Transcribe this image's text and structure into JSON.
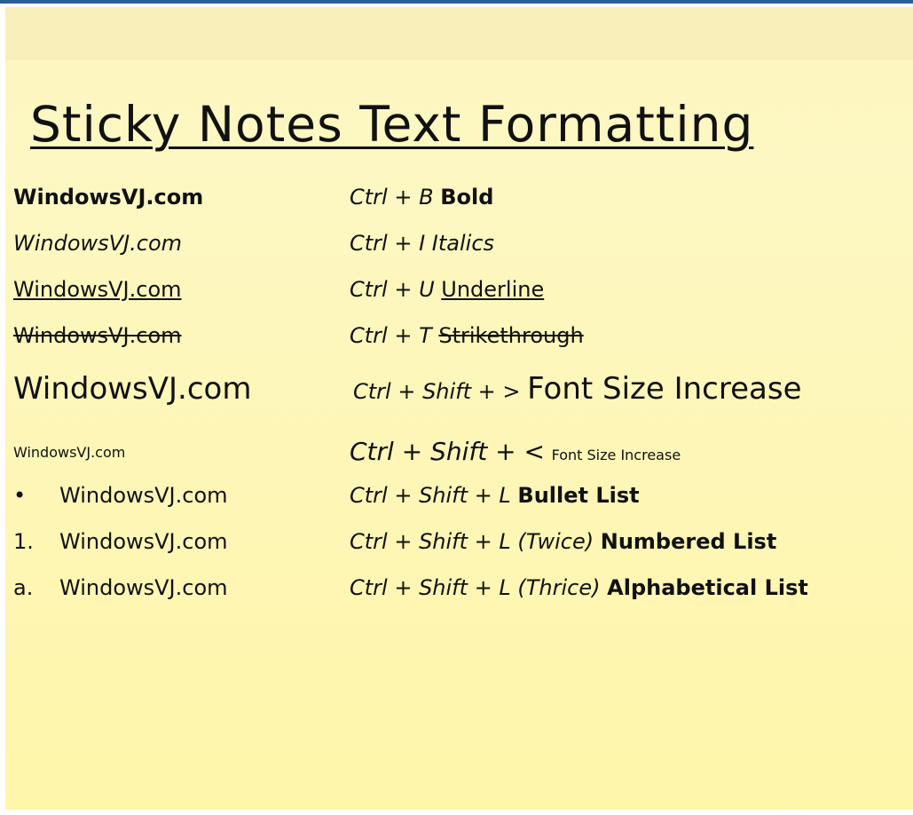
{
  "title": "Sticky Notes Text Formatting",
  "colors": {
    "note_background": "#fdf6bf",
    "window_border": "#2c5e93",
    "text": "#111111"
  },
  "rows": [
    {
      "left": "WindowsVJ.com",
      "shortcut": "Ctrl + B",
      "effect": "Bold"
    },
    {
      "left": "WindowsVJ.com",
      "shortcut": "Ctrl + I",
      "effect": "Italics"
    },
    {
      "left": "WindowsVJ.com",
      "shortcut": "Ctrl + U",
      "effect": "Underline"
    },
    {
      "left": "WindowsVJ.com",
      "shortcut": "Ctrl + T",
      "effect": "Strikethrough"
    },
    {
      "left": "WindowsVJ.com",
      "shortcut": "Ctrl + Shift + >",
      "effect": "Font Size Increase"
    },
    {
      "left": "WindowsVJ.com",
      "shortcut": "Ctrl + Shift + <",
      "effect": "Font Size Increase"
    },
    {
      "marker": "•",
      "left": "WindowsVJ.com",
      "shortcut": "Ctrl + Shift + L",
      "effect": "Bullet List"
    },
    {
      "marker": "1.",
      "left": "WindowsVJ.com",
      "shortcut": "Ctrl + Shift + L (Twice)",
      "effect": "Numbered List"
    },
    {
      "marker": "a.",
      "left": "WindowsVJ.com",
      "shortcut": "Ctrl + Shift + L (Thrice)",
      "effect": "Alphabetical List"
    }
  ]
}
